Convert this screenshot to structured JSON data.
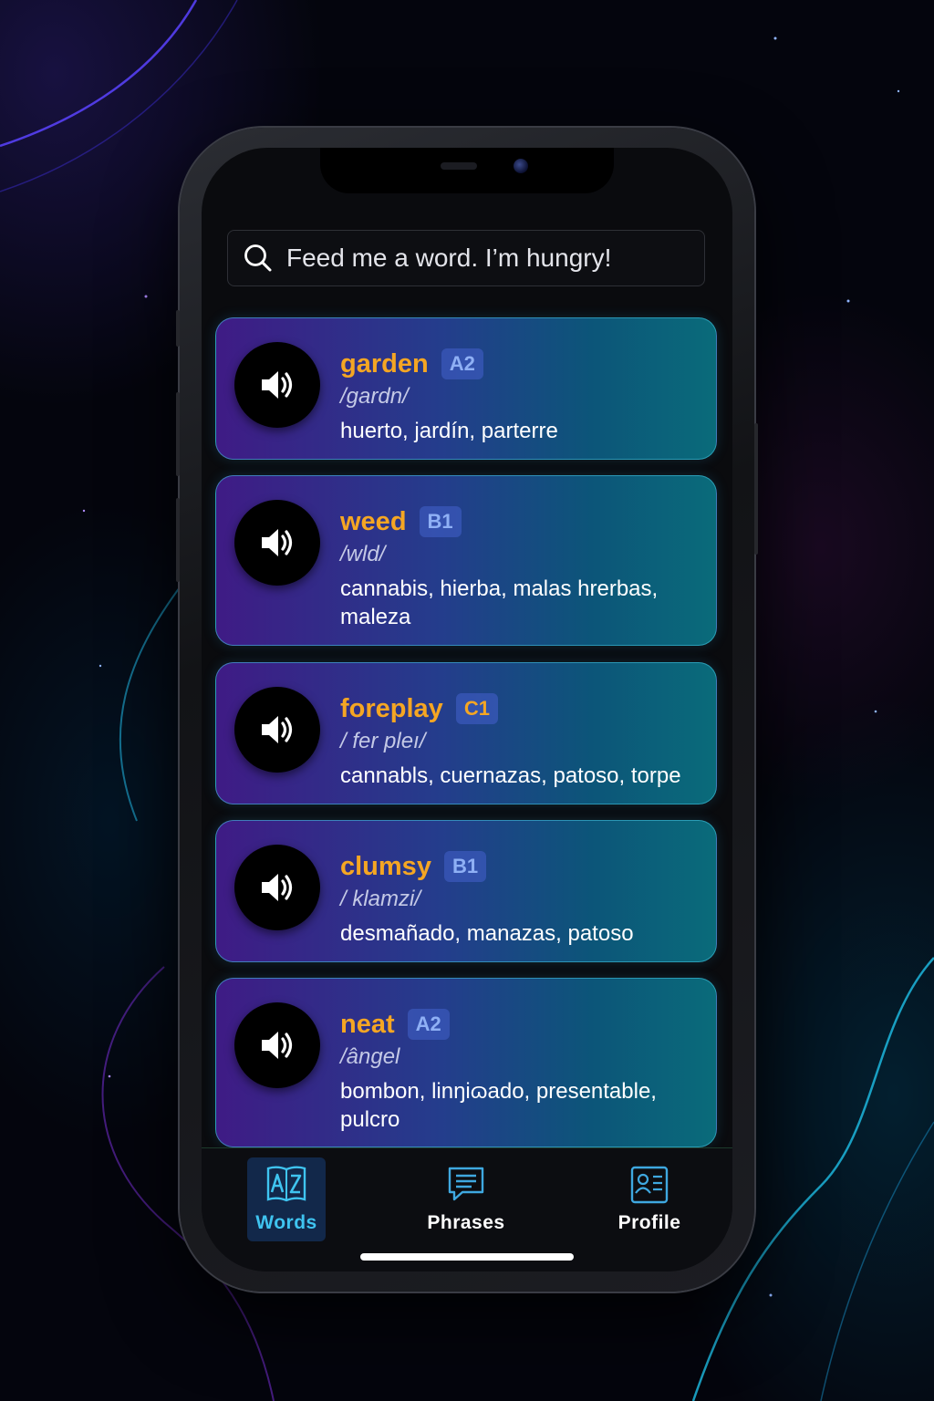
{
  "search": {
    "placeholder": "Feed me a word. I’m hungry!"
  },
  "words": [
    {
      "word": "garden",
      "level": "A2",
      "ipa": "/gardn/",
      "translation": "huerto, jardín, parterre"
    },
    {
      "word": "weed",
      "level": "B1",
      "ipa": "/wld/",
      "translation": "cannabis, hierba, malas hrerbas, maleza"
    },
    {
      "word": "foreplay",
      "level": "C1",
      "ipa": "/ fer pleı/",
      "translation": "cannabls, cuernazas, patoso, torpe"
    },
    {
      "word": "clumsy",
      "level": "B1",
      "ipa": "/ klamzi/",
      "translation": "desmañado, manazas, patoso"
    },
    {
      "word": "neat",
      "level": "A2",
      "ipa": "/ângel",
      "translation": "bombon, linŋiɷado, presentable, pulcro"
    }
  ],
  "tabs": [
    {
      "label": "Words",
      "icon": "az-dictionary-icon",
      "active": true
    },
    {
      "label": "Phrases",
      "icon": "chat-bubble-icon",
      "active": false
    },
    {
      "label": "Profile",
      "icon": "id-card-icon",
      "active": false
    }
  ],
  "colors": {
    "word": "#f5a623",
    "active_tab": "#3fc4f0",
    "card_start": "#3f1b85",
    "card_end": "#0a6b7a"
  }
}
